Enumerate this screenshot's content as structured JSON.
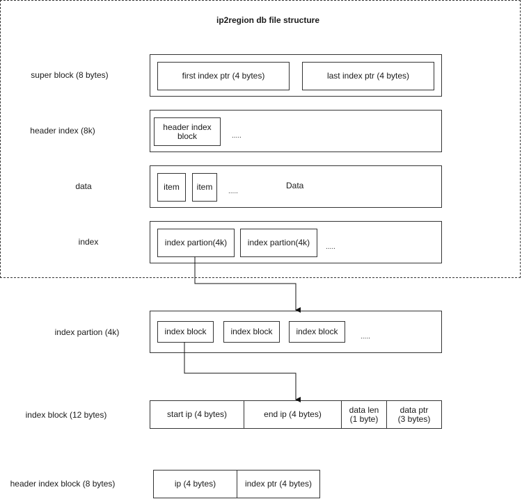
{
  "title": "ip2region db file structure",
  "rows": {
    "super_block": {
      "label": "super block (8 bytes)",
      "fields": [
        "first index ptr (4 bytes)",
        "last index ptr (4 bytes)"
      ]
    },
    "header_index": {
      "label": "header index (8k)",
      "block": "header index block",
      "ellipsis": "....."
    },
    "data": {
      "label": "data",
      "items": [
        "item",
        "item"
      ],
      "ellipsis": ".....",
      "caption": "Data"
    },
    "index": {
      "label": "index",
      "partitions": [
        "index partion(4k)",
        "index partion(4k)"
      ],
      "ellipsis": "....."
    },
    "index_partition": {
      "label": "index partion (4k)",
      "blocks": [
        "index block",
        "index block",
        "index block"
      ],
      "ellipsis": "....."
    },
    "index_block": {
      "label": "index block (12 bytes)",
      "fields": [
        "start ip (4 bytes)",
        "end ip (4 bytes)",
        "data len\n(1 byte)",
        "data ptr\n(3 bytes)"
      ]
    },
    "header_index_block": {
      "label": "header index block (8 bytes)",
      "fields": [
        "ip (4 bytes)",
        "index ptr (4 bytes)"
      ]
    }
  }
}
